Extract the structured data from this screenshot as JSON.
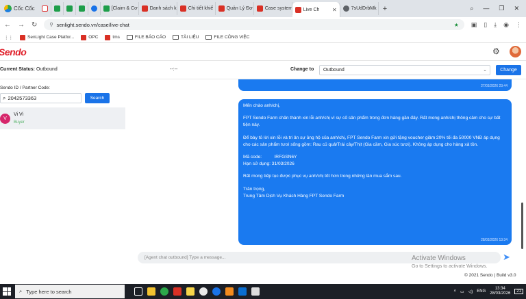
{
  "browser": {
    "brand": "Cốc Cốc",
    "tabs": [
      {
        "label": "",
        "icon": "gmail-icon"
      },
      {
        "label": "",
        "icon": "sheets-icon"
      },
      {
        "label": "",
        "icon": "sheets-icon"
      },
      {
        "label": "",
        "icon": "sheets-icon"
      },
      {
        "label": "",
        "icon": "messenger-icon"
      },
      {
        "label": "[Claim & Cơ",
        "icon": "sheets-icon"
      },
      {
        "label": "Danh sách k",
        "icon": "sendo-icon"
      },
      {
        "label": "Chi tiết khiế",
        "icon": "sendo-icon"
      },
      {
        "label": "Quản Lý Đơ",
        "icon": "sendo-icon"
      },
      {
        "label": "Case system",
        "icon": "sendo-icon"
      },
      {
        "label": "Live Ch",
        "icon": "sendo-icon",
        "active": true
      },
      {
        "label": "7sUdDrbMk",
        "icon": "globe-icon"
      }
    ],
    "new_tab": "+",
    "url": "senlight.sendo.vn/case/live-chat",
    "bookmarks": [
      {
        "label": "SenLight Case Platfor...",
        "type": "site"
      },
      {
        "label": "OPC",
        "type": "site"
      },
      {
        "label": "tms",
        "type": "site"
      },
      {
        "label": "FILE BÁO CÁO",
        "type": "folder"
      },
      {
        "label": "TÀI LIỆU",
        "type": "folder"
      },
      {
        "label": "FILE CÔNG VIỆC",
        "type": "folder"
      }
    ]
  },
  "app": {
    "logo": "Sendo",
    "status_label": "Current Status:",
    "status_value": "Outbound",
    "timer": "--:--",
    "change_to_label": "Change to",
    "change_to_value": "Outbound",
    "change_button": "Change"
  },
  "left_panel": {
    "search_label": "Sendo ID / Partner Code:",
    "search_value": "2042573363",
    "search_button": "Search",
    "contacts": [
      {
        "initial": "V",
        "name": "Vi Vi",
        "role": "Buyer"
      }
    ]
  },
  "chat": {
    "previous_timestamp": "27/03/2026 23:44",
    "message_paragraphs": [
      "Mến chào anh/chị,",
      "FPT Sendo Farm chân thành xin lỗi anh/chị vì sự cố sản phẩm trong đơn hàng gần đây. Rất mong anh/chị thông cảm cho sự bất tiện này.",
      "Để bày tỏ lời xin lỗi và tri ân sự ủng hộ của anh/chị, FPT Sendo Farm xin gửi tặng voucher giảm 20% tối đa 50000 VNĐ áp dụng cho các sản phẩm tươi sống gồm: Rau củ quả/Trái cây/Thịt (Gia cầm, Gia súc tươi). Không áp dụng cho hàng xả tồn.",
      "Mã code:          IRFGSN6Y\nHạn sử dụng: 31/03/2026",
      "Rất mong tiếp tục được phục vụ anh/chị tốt hơn trong những lần mua sắm sau.",
      "Trân trọng,\nTrung Tâm Dịch Vụ Khách Hàng FPT Sendo Farm"
    ],
    "message_timestamp": "28/03/2026 13:34",
    "composer_placeholder": "[Agent chat outbound] Type a message...",
    "watermark_title": "Activate Windows",
    "watermark_sub": "Go to Settings to activate Windows."
  },
  "footer": "© 2021 Sendo | Build v3.0",
  "taskbar": {
    "search_placeholder": "Type here to search",
    "time": "13:34",
    "date": "28/03/2026",
    "notification_count": "21"
  },
  "colors": {
    "brand_red": "#e0202a",
    "primary_blue": "#1a73e8",
    "bubble_blue": "#1a7af0"
  }
}
